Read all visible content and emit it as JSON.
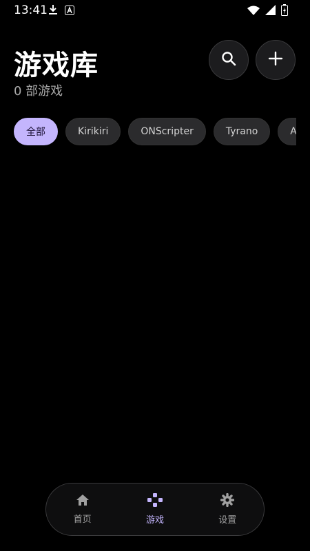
{
  "status_bar": {
    "time": "13:41",
    "left_icons": [
      "download-icon",
      "a-badge-icon"
    ],
    "right_icons": [
      "wifi-icon",
      "signal-icon",
      "battery-charging-icon"
    ]
  },
  "header": {
    "title": "游戏库",
    "subtitle": "0 部游戏",
    "search_icon": "search-icon",
    "add_icon": "add-icon"
  },
  "filters": [
    {
      "label": "全部",
      "active": true
    },
    {
      "label": "Kirikiri",
      "active": false
    },
    {
      "label": "ONScripter",
      "active": false
    },
    {
      "label": "Tyrano",
      "active": false
    },
    {
      "label": "A",
      "active": false
    }
  ],
  "bottom_nav": {
    "items": [
      {
        "label": "首页",
        "icon": "home-icon",
        "active": false
      },
      {
        "label": "游戏",
        "icon": "gamepad-icon",
        "active": true
      },
      {
        "label": "设置",
        "icon": "gear-icon",
        "active": false
      }
    ]
  },
  "colors": {
    "accent": "#c4b5fd",
    "background": "#000000",
    "chip_bg": "#2b2b2d"
  }
}
